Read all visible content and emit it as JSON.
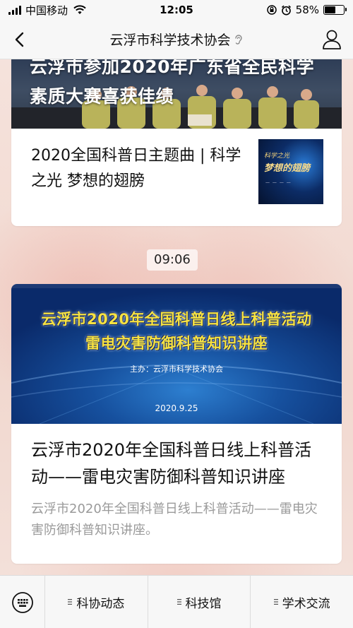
{
  "status_bar": {
    "carrier": "中国移动",
    "time": "12:05",
    "battery": "58%",
    "battery_level": 0.58
  },
  "nav": {
    "title": "云浮市科学技术协会"
  },
  "card1": {
    "banner_title": "云浮市参加2020年广东省全民科学素质大赛喜获佳绩",
    "item_title": "2020全国科普日主题曲 | 科学之光 梦想的翅膀",
    "thumb_small": "科学之光",
    "thumb_main": "梦想的翅膀"
  },
  "timestamp": "09:06",
  "card2": {
    "banner_line1": "云浮市2020年全国科普日线上科普活动",
    "banner_line2": "雷电灾害防御科普知识讲座",
    "banner_host": "主办：云浮市科学技术协会",
    "banner_date": "2020.9.25",
    "title": "云浮市2020年全国科普日线上科普活动——雷电灾害防御科普知识讲座",
    "description": "云浮市2020年全国科普日线上科普活动——雷电灾害防御科普知识讲座。"
  },
  "tabs": [
    {
      "label": "科协动态"
    },
    {
      "label": "科技馆"
    },
    {
      "label": "学术交流"
    }
  ],
  "icons": {
    "back": "chevron-left-icon",
    "profile": "person-icon",
    "keyboard": "keyboard-icon",
    "menu": "menu-lines-icon"
  }
}
